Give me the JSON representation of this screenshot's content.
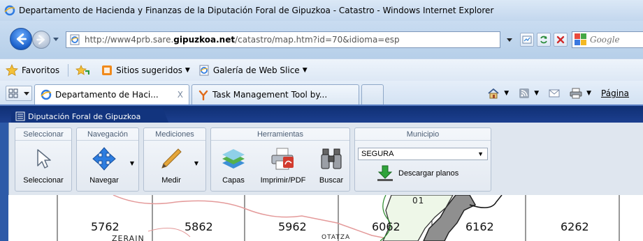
{
  "window": {
    "title": "Departamento de Hacienda y Finanzas de la Diputación Foral de Gipuzkoa - Catastro - Windows Internet Explorer"
  },
  "address": {
    "url_prefix": "http://www4prb.sare.",
    "url_domain": "gipuzkoa.net",
    "url_suffix": "/catastro/map.htm?id=70&idioma=esp"
  },
  "search": {
    "placeholder": "Google"
  },
  "favorites": {
    "label": "Favoritos",
    "items": [
      {
        "label": "Sitios sugeridos"
      },
      {
        "label": "Galería de Web Slice"
      }
    ]
  },
  "tabs": [
    {
      "label": "Departamento de Haci...",
      "close": "X"
    },
    {
      "label": "Task Management Tool by..."
    }
  ],
  "command_bar": {
    "page_label": "Página"
  },
  "app": {
    "tab_label": "Diputación Foral de Gipuzkoa"
  },
  "ribbon": {
    "groups": [
      {
        "title": "Seleccionar",
        "tools": [
          {
            "label": "Seleccionar"
          }
        ]
      },
      {
        "title": "Navegación",
        "tools": [
          {
            "label": "Navegar"
          }
        ]
      },
      {
        "title": "Mediciones",
        "tools": [
          {
            "label": "Medir"
          }
        ]
      },
      {
        "title": "Herramientas",
        "tools": [
          {
            "label": "Capas"
          },
          {
            "label": "Imprimir/PDF"
          },
          {
            "label": "Buscar"
          }
        ]
      },
      {
        "title": "Municipio",
        "selected": "SEGURA",
        "download_label": "Descargar planos"
      }
    ]
  },
  "map": {
    "cells": [
      "5762",
      "5862",
      "5962",
      "6062",
      "6162",
      "6262"
    ],
    "places": [
      "ZERAIN",
      "OTATZA",
      "01"
    ]
  },
  "colors": {
    "app_header": "#0f2f74",
    "ribbon_bg": "#dfe6ef",
    "map_boundary": "#e08080"
  }
}
